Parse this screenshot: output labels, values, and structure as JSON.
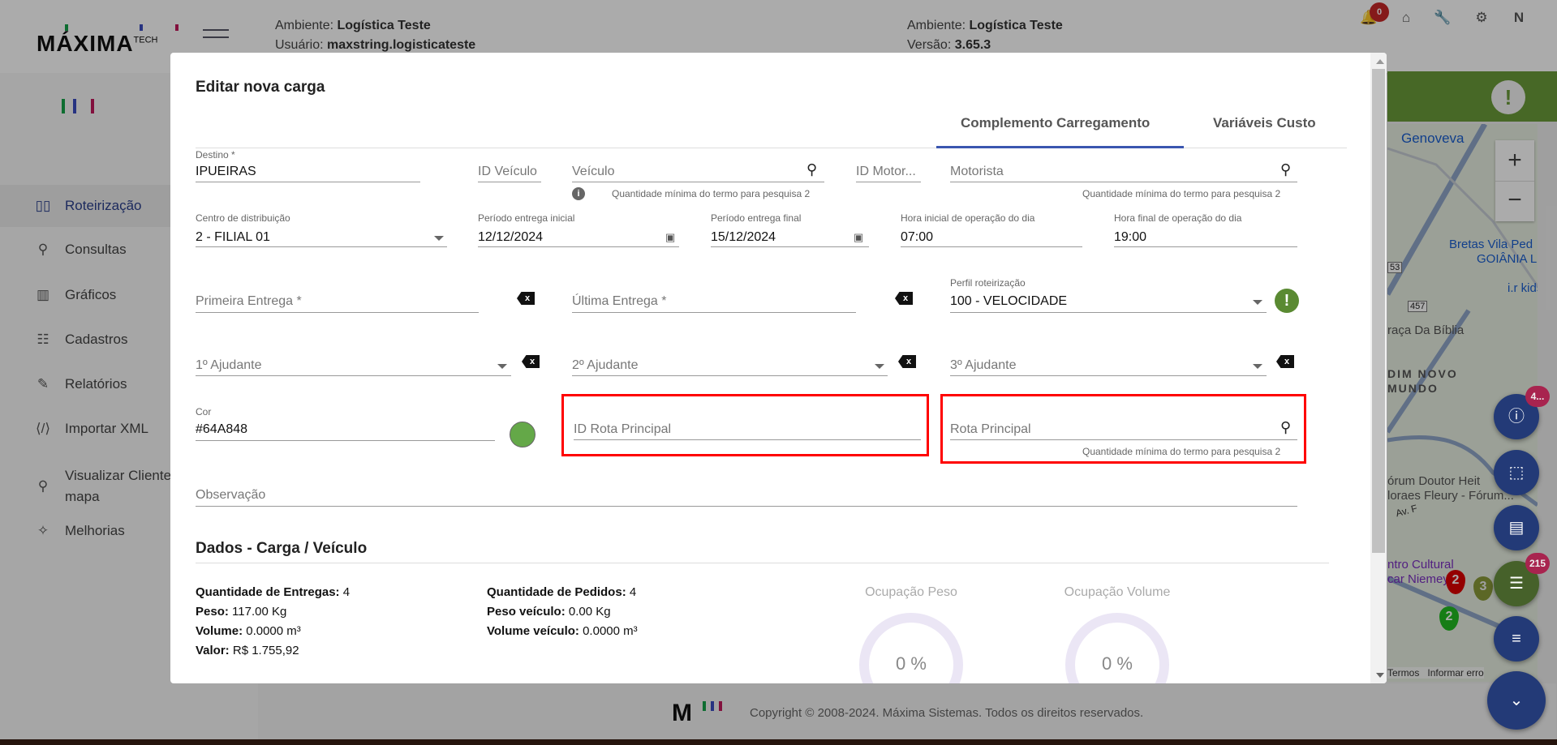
{
  "header": {
    "logo": "MÁXIMA",
    "logo_sup": "TECH",
    "env_label": "Ambiente:",
    "env_value": "Logística Teste",
    "user_label": "Usuário:",
    "user_value": "maxstring.logisticateste",
    "env2_label": "Ambiente:",
    "env2_value": "Logística Teste",
    "version_label": "Versão:",
    "version_value": "3.65.3",
    "notifications": "0",
    "icons": [
      "bell-icon",
      "home-icon",
      "wrench-icon",
      "gear-icon",
      "n-icon"
    ]
  },
  "sidebar": {
    "items": [
      {
        "label": "Roteirização",
        "icon": "map-icon",
        "glyph": "🗺"
      },
      {
        "label": "Consultas",
        "icon": "search-icon",
        "glyph": "⚲"
      },
      {
        "label": "Gráficos",
        "icon": "bar-chart-icon",
        "glyph": "▥"
      },
      {
        "label": "Cadastros",
        "icon": "sliders-icon",
        "glyph": "☷"
      },
      {
        "label": "Relatórios",
        "icon": "edit-icon",
        "glyph": "✎"
      },
      {
        "label": "Importar XML",
        "icon": "xml-file-icon",
        "glyph": "⌘"
      },
      {
        "label": "Visualizar Clientes no",
        "label2": "mapa",
        "icon": "pin-icon",
        "glyph": "⚲"
      },
      {
        "label": "Melhorias",
        "icon": "magic-wand-icon",
        "glyph": "✧"
      }
    ]
  },
  "map": {
    "labels": [
      "Genoveva",
      "Bretas Vila Ped",
      "GOIÂNIA LI",
      "i.r kids",
      "raça Da Bíblia",
      "DIM NOVO",
      "MUNDO",
      "órum Doutor Heit",
      "loraes Fleury - Fórum...",
      "Av. F",
      "ntro Cultural",
      "car Niemeyer",
      "Termos",
      "Informar erro"
    ],
    "shields": [
      "53",
      "457"
    ],
    "markers": [
      "2",
      "3",
      "2"
    ],
    "badges": {
      "alerts": "4...",
      "list": "215"
    }
  },
  "footer": {
    "copyright": "Copyright © 2008-2024. Máxima Sistemas. Todos os direitos reservados."
  },
  "modal": {
    "title": "Editar nova carga",
    "tabs": [
      "Complemento Carregamento",
      "Variáveis Custo"
    ],
    "destino": {
      "label": "Destino *",
      "value": "IPUEIRAS"
    },
    "id_veiculo": {
      "placeholder": "ID Veículo"
    },
    "veiculo": {
      "placeholder": "Veículo",
      "hint": "Quantidade mínima do termo para pesquisa 2"
    },
    "id_motorista": {
      "placeholder": "ID Motor..."
    },
    "motorista": {
      "placeholder": "Motorista",
      "hint": "Quantidade mínima do termo para pesquisa 2"
    },
    "centro": {
      "label": "Centro de distribuição",
      "value": "2 - FILIAL 01"
    },
    "periodo_inicial": {
      "label": "Período entrega inicial",
      "value": "12/12/2024"
    },
    "periodo_final": {
      "label": "Período entrega final",
      "value": "15/12/2024"
    },
    "hora_inicial": {
      "label": "Hora inicial de operação do dia",
      "value": "07:00"
    },
    "hora_final": {
      "label": "Hora final de operação do dia",
      "value": "19:00"
    },
    "primeira_entrega": {
      "placeholder": "Primeira Entrega *"
    },
    "ultima_entrega": {
      "placeholder": "Última Entrega *"
    },
    "perfil": {
      "label": "Perfil roteirização",
      "value": "100 - VELOCIDADE"
    },
    "ajudante1": {
      "placeholder": "1º Ajudante"
    },
    "ajudante2": {
      "placeholder": "2º Ajudante"
    },
    "ajudante3": {
      "placeholder": "3º Ajudante"
    },
    "cor": {
      "label": "Cor",
      "value": "#64A848",
      "swatch": "#64A848"
    },
    "id_rota": {
      "placeholder": "ID Rota Principal"
    },
    "rota": {
      "placeholder": "Rota Principal",
      "hint": "Quantidade mínima do termo para pesquisa 2"
    },
    "observacao": {
      "placeholder": "Observação"
    },
    "dados": {
      "title": "Dados - Carga / Veículo",
      "col1": [
        {
          "k": "Quantidade de Entregas:",
          "v": "4"
        },
        {
          "k": "Peso:",
          "v": "117.00 Kg"
        },
        {
          "k": "Volume:",
          "v": "0.0000 m³"
        },
        {
          "k": "Valor:",
          "v": "R$ 1.755,92"
        }
      ],
      "col2": [
        {
          "k": "Quantidade de Pedidos:",
          "v": "4"
        },
        {
          "k": "Peso veículo:",
          "v": "0.00 Kg"
        },
        {
          "k": "Volume veículo:",
          "v": "0.0000 m³"
        }
      ],
      "ocupacao_peso": {
        "label": "Ocupação Peso",
        "value": "0 %",
        "percent": 0
      },
      "ocupacao_volume": {
        "label": "Ocupação Volume",
        "value": "0 %",
        "percent": 0
      }
    }
  },
  "colors": {
    "accent": "#2b4390",
    "tab_underline": "#3a56b0",
    "green": "#64A848",
    "highlight": "#ff0000"
  }
}
